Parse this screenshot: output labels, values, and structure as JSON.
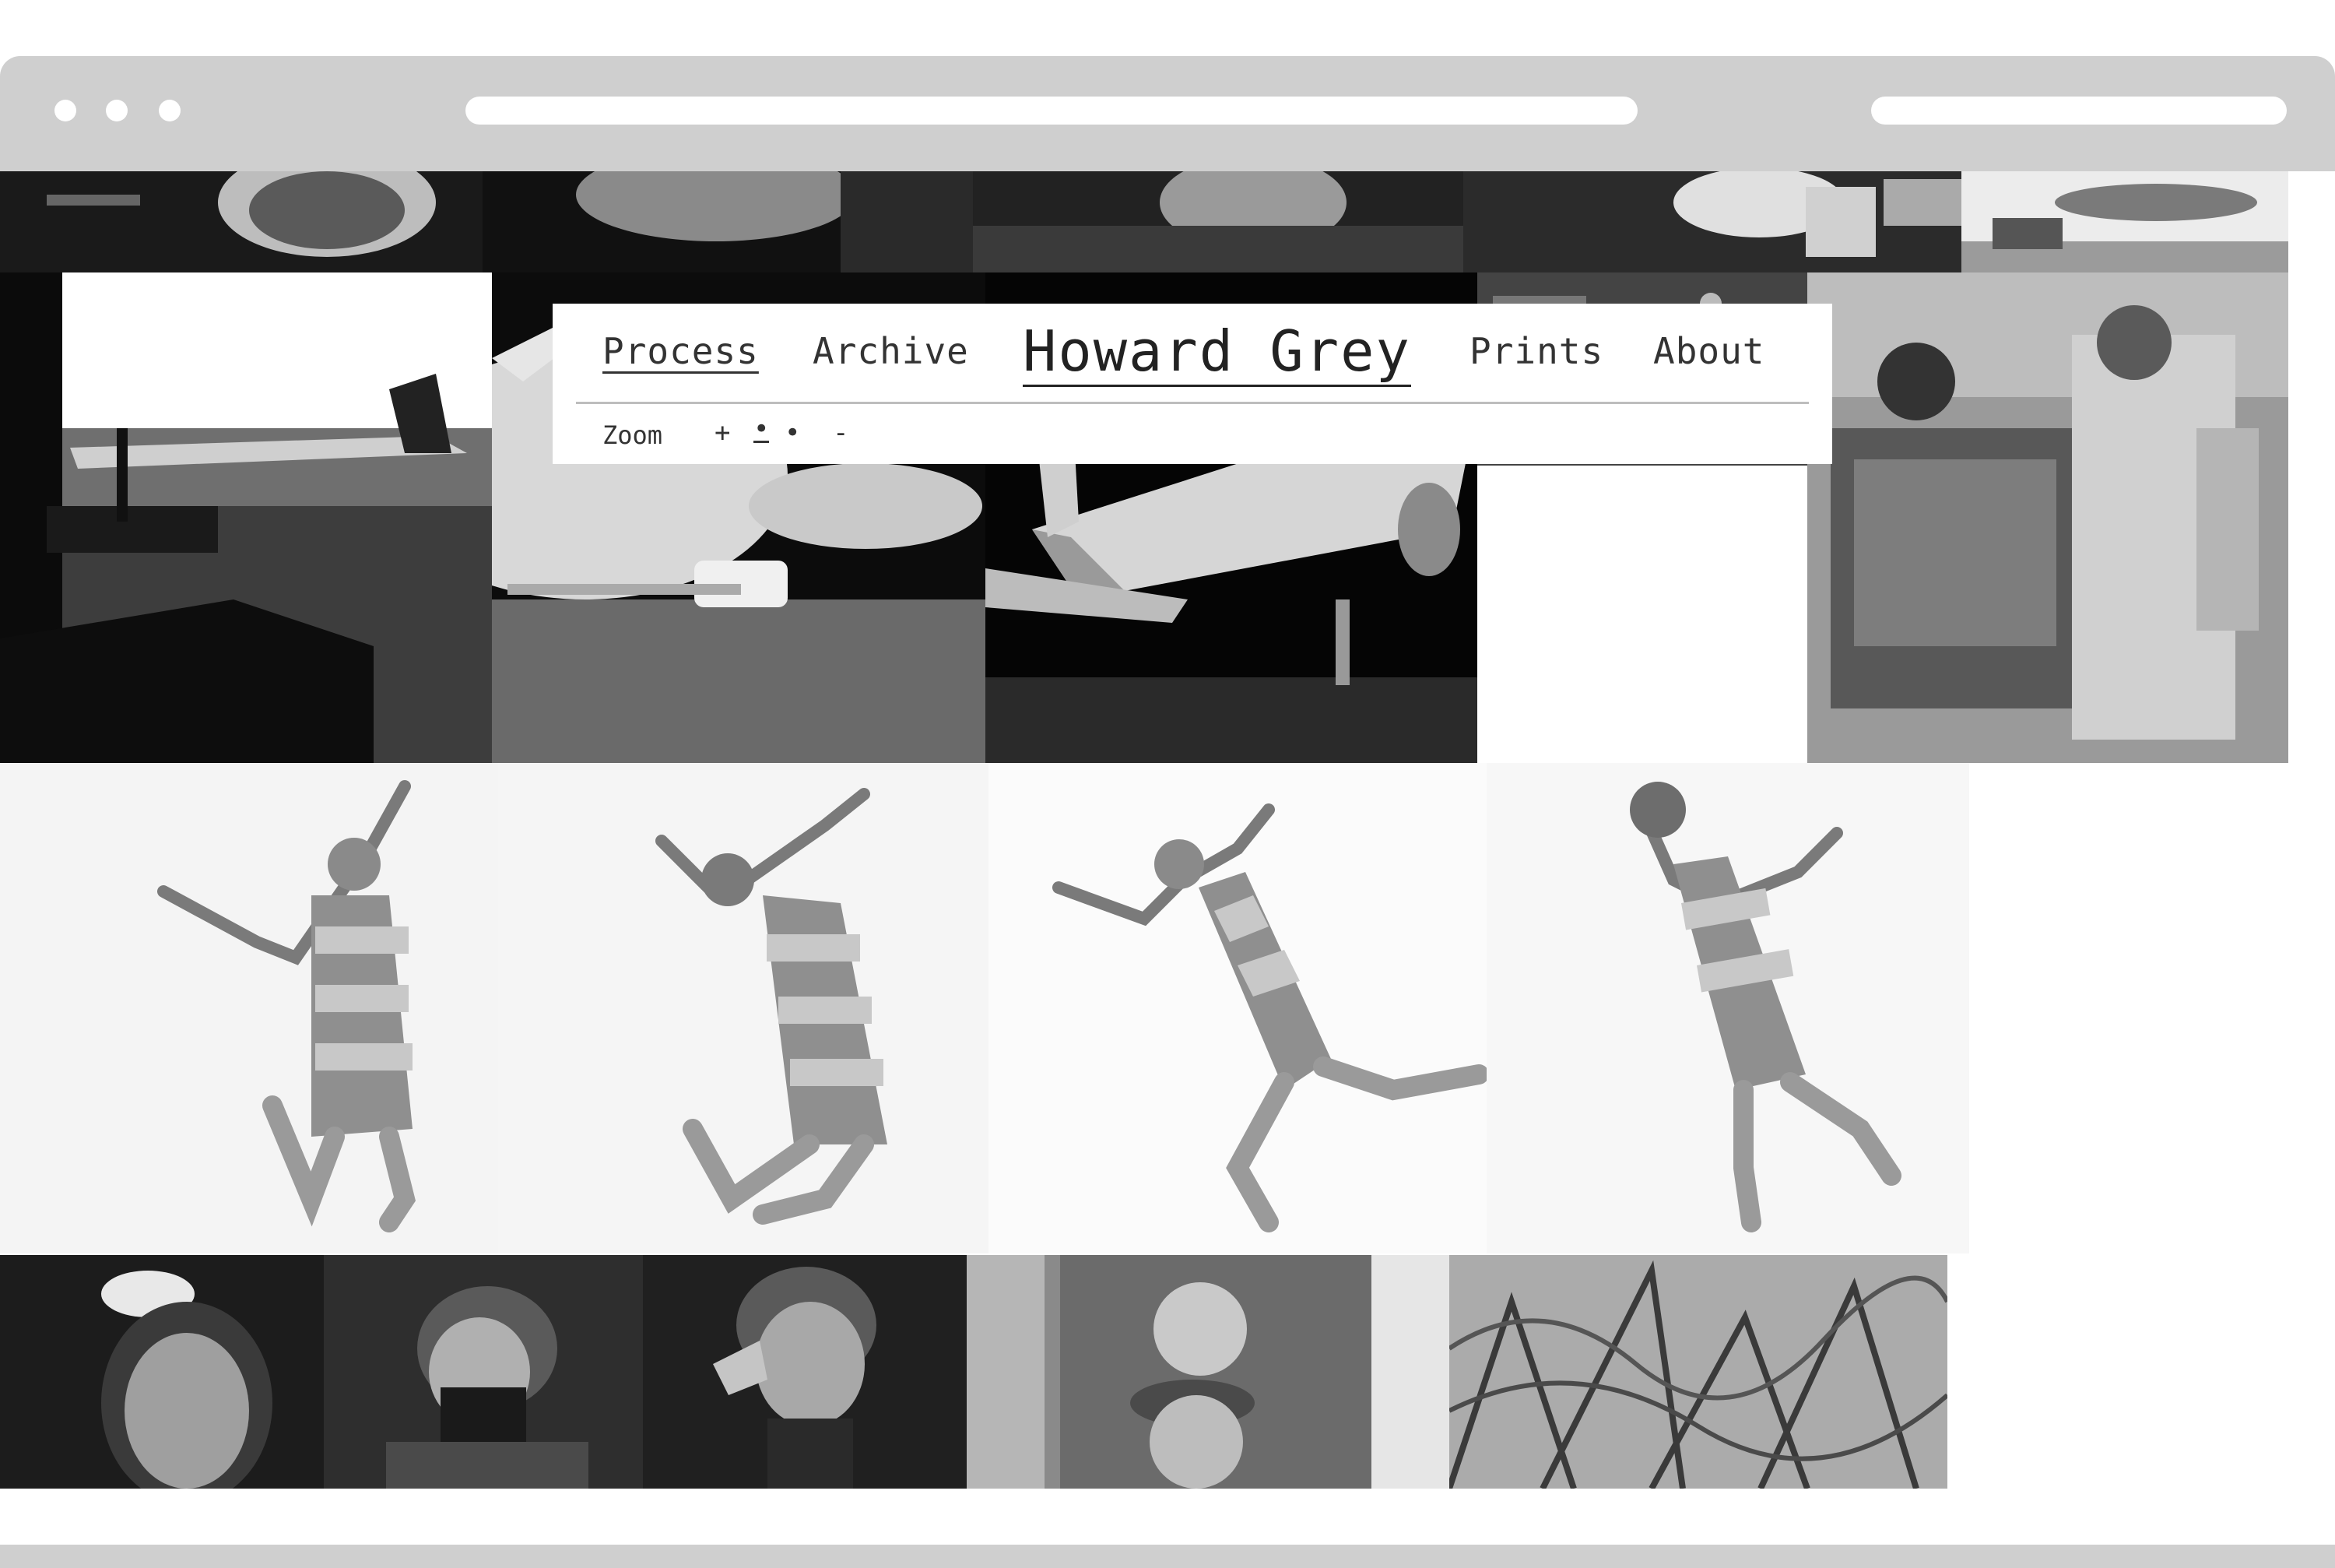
{
  "site": {
    "title": "Howard Grey",
    "nav": [
      {
        "label": "Process",
        "active": true
      },
      {
        "label": "Archive",
        "active": false
      },
      {
        "label": "Prints",
        "active": false
      },
      {
        "label": "About",
        "active": false
      }
    ],
    "zoom": {
      "label": "Zoom",
      "plus": "+",
      "levels": [
        "•",
        "•"
      ],
      "minus": "-"
    }
  },
  "colors": {
    "chrome": "#cfcfcf",
    "text": "#333333",
    "photo_dark": "#111111",
    "photo_light": "#f4f4f4"
  },
  "icons": [
    "window-dot-icon",
    "zoom-plus-icon",
    "zoom-minus-icon"
  ]
}
